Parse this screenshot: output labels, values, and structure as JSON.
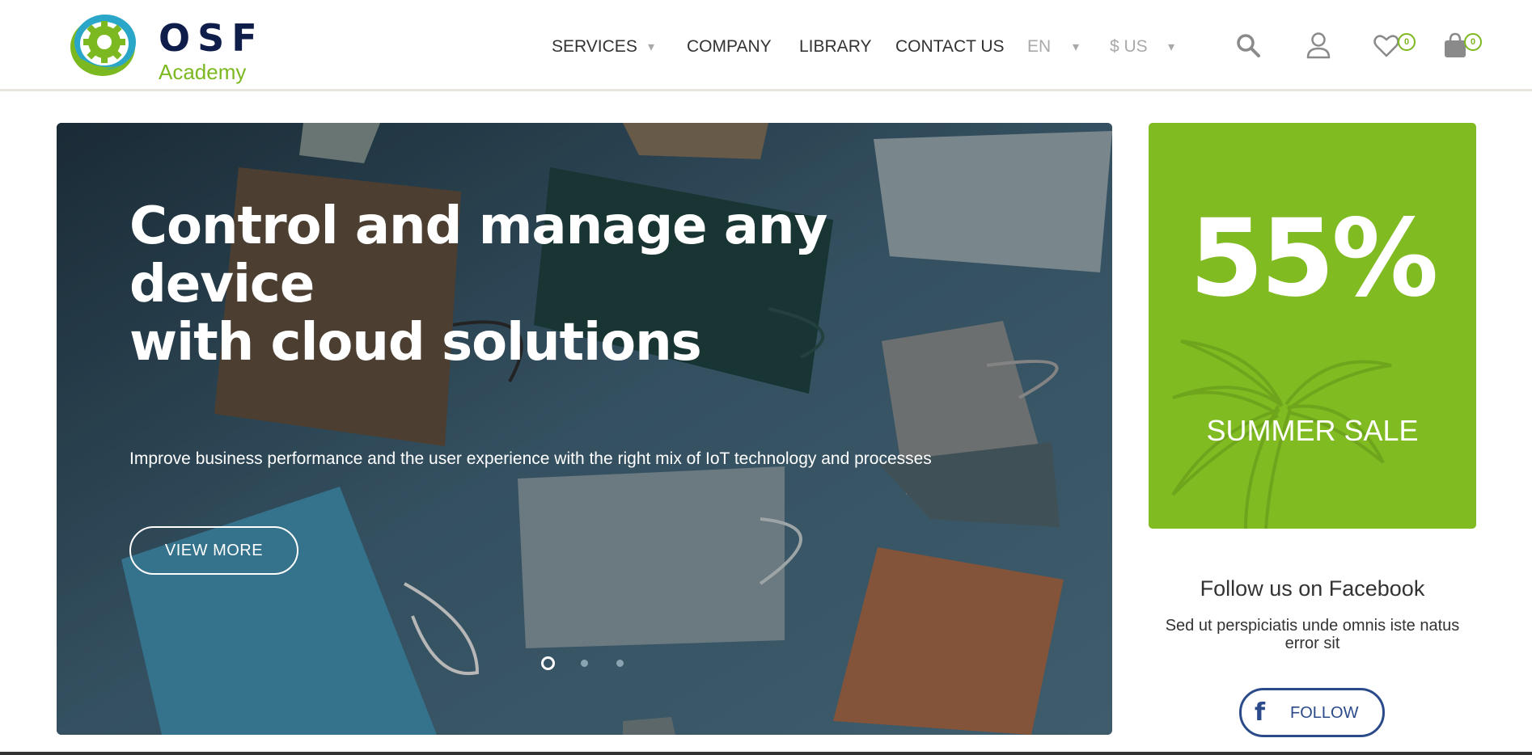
{
  "brand": {
    "name": "OSF",
    "sub": "Academy",
    "colors": {
      "navy": "#0f1d4a",
      "green": "#7cb820",
      "teal": "#2aa6c8"
    }
  },
  "nav": {
    "items": [
      "SERVICES",
      "COMPANY",
      "LIBRARY",
      "CONTACT US"
    ],
    "language": "EN",
    "currency": "$ US",
    "caret": "▾"
  },
  "header_icons": {
    "search": "search-icon",
    "account": "user-icon",
    "wishlist": "heart-icon",
    "cart": "shopping-bag-icon",
    "wishlist_count": "0",
    "cart_count": "0"
  },
  "hero": {
    "title_line1": "Control and manage any device",
    "title_line2": "with cloud solutions",
    "subtitle": "Improve business performance and the user experience with the right mix of IoT technology and processes",
    "button": "VIEW MORE",
    "slides_total": 3,
    "active_slide": 1
  },
  "sale": {
    "percent": "55%",
    "label": "SUMMER SALE",
    "color": "#80bb22"
  },
  "facebook": {
    "title": "Follow us on Facebook",
    "text": "Sed ut perspiciatis unde omnis iste natus error sit",
    "button_icon": "f",
    "button_label": "FOLLOW",
    "color": "#2a4a8a"
  }
}
